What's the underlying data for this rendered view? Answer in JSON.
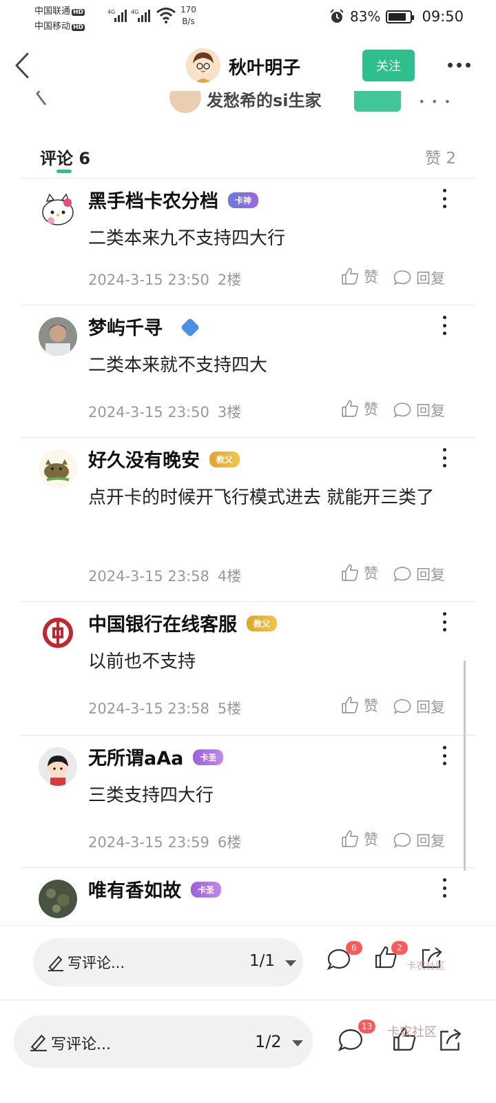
{
  "status_bar": {
    "carrier1": "中国联通",
    "carrier2": "中国移动",
    "hd": "HD",
    "net_type": "4G",
    "net_speed_value": "170",
    "net_speed_unit": "B/s",
    "battery": "83%",
    "battery_level": 0.83,
    "time": "09:50"
  },
  "header": {
    "name": "秋叶明子",
    "follow_label": "关注"
  },
  "ghost_header": {
    "name": "发愁希的si生家"
  },
  "tabs": {
    "comments_label": "评论 6",
    "likes_label": "赞 2"
  },
  "comments": [
    {
      "name": "黑手档卡农分档",
      "badge": "卡神",
      "text": "二类本来九不支持四大行",
      "date": "2024-3-15 23:50",
      "floor": "2楼",
      "like_label": "赞",
      "reply_label": "回复"
    },
    {
      "name": "梦屿千寻",
      "badge": "",
      "text": "二类本来就不支持四大",
      "date": "2024-3-15 23:50",
      "floor": "3楼",
      "like_label": "赞",
      "reply_label": "回复"
    },
    {
      "name": "好久没有晚安",
      "badge": "教父",
      "text": "点开卡的时候开飞行模式进去 就能开三类了",
      "date": "2024-3-15 23:58",
      "floor": "4楼",
      "like_label": "赞",
      "reply_label": "回复"
    },
    {
      "name": "中国银行在线客服",
      "badge": "教父",
      "text": "以前也不支持",
      "date": "2024-3-15 23:58",
      "floor": "5楼",
      "like_label": "赞",
      "reply_label": "回复"
    },
    {
      "name": "无所谓aAa",
      "badge": "卡圣",
      "text": "三类支持四大行",
      "date": "2024-3-15 23:59",
      "floor": "6楼",
      "like_label": "赞",
      "reply_label": "回复"
    },
    {
      "name": "唯有香如故",
      "badge": "卡圣",
      "text": "",
      "date": "",
      "floor": "",
      "like_label": "",
      "reply_label": ""
    }
  ],
  "bottom_bar1": {
    "placeholder": "写评论...",
    "page": "1/1",
    "comment_count": "6",
    "like_count": "2",
    "watermark": "卡农社区"
  },
  "bottom_bar2": {
    "placeholder": "写评论...",
    "page": "1/2",
    "comment_count": "13",
    "watermark": "卡农社区"
  },
  "colors": {
    "accent": "#2ebf8d",
    "badge_red": "#ff5a5a",
    "badge_gold": "#d9a528",
    "badge_purple": "#8b5cd6",
    "badge_blue": "#5b7bd8"
  }
}
